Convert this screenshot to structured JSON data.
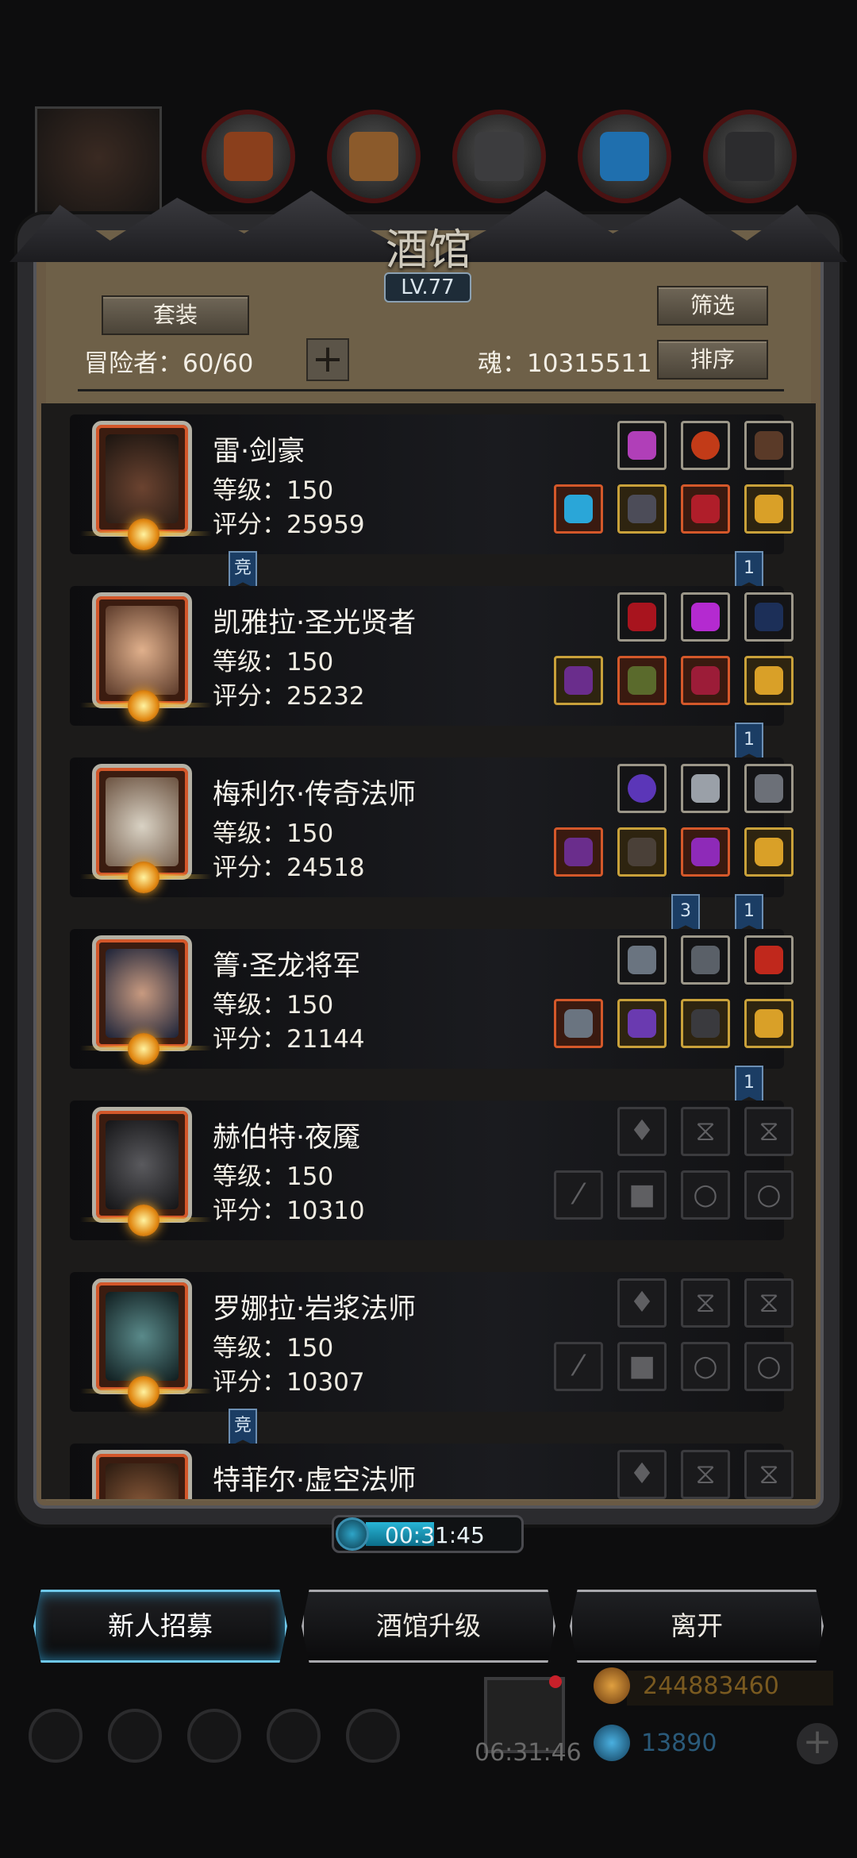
{
  "panel": {
    "title": "酒馆",
    "level": "LV.77",
    "suit_label": "套装",
    "filter_label": "筛选",
    "sort_label": "排序",
    "adventurers": "冒险者：60/60",
    "add_label": "+",
    "soul": "魂：10315511"
  },
  "heroes": [
    {
      "name": "雷·剑豪",
      "level": "等级：150",
      "score": "评分：25959"
    },
    {
      "name": "凯雅拉·圣光贤者",
      "level": "等级：150",
      "score": "评分：25232"
    },
    {
      "name": "梅利尔·传奇法师",
      "level": "等级：150",
      "score": "评分：24518"
    },
    {
      "name": "箐·圣龙将军",
      "level": "等级：150",
      "score": "评分：21144"
    },
    {
      "name": "赫伯特·夜魇",
      "level": "等级：150",
      "score": "评分：10310"
    },
    {
      "name": "罗娜拉·岩浆法师",
      "level": "等级：150",
      "score": "评分：10307"
    },
    {
      "name": "特菲尔·虚空法师"
    }
  ],
  "tags": {
    "arena": "竞",
    "one": "1",
    "three": "3"
  },
  "timer": {
    "text": "00:31:45",
    "progress": 0.45
  },
  "buttons": {
    "recruit": "新人招募",
    "upgrade": "酒馆升级",
    "leave": "离开"
  },
  "background": {
    "gift_timer": "06:31:46",
    "gold": "244883460",
    "gems": "13890"
  },
  "colors": {
    "accent_blue": "#6fc8ea",
    "frame_orange": "#d4582a",
    "frame_gold": "#c9a13a",
    "panel_brown": "#6e6048"
  }
}
